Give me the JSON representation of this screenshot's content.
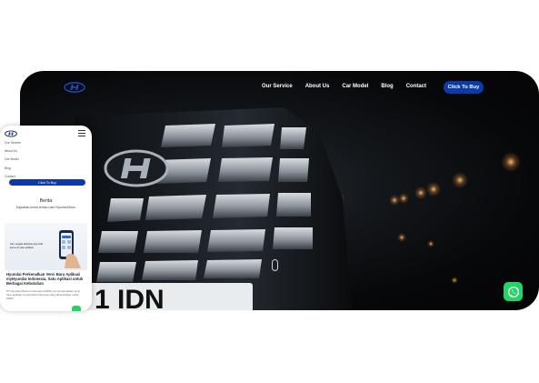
{
  "desktop": {
    "nav": {
      "items": [
        "Our Service",
        "About Us",
        "Car Model",
        "Blog",
        "Contact"
      ],
      "cta_label": "Click To Buy"
    },
    "colors": {
      "accent": "#0c3aa8",
      "whatsapp": "#25d366",
      "hero_bg": "#07080a"
    },
    "hero_plate_text": "1 IDN"
  },
  "mobile": {
    "nav": {
      "items": [
        "Our Service",
        "About Us",
        "Car Model",
        "Blog",
        "Contact"
      ],
      "cta_label": "Click To Buy"
    },
    "section_title": "Berita",
    "section_subtitle": "Dapatkan berita terbaru dari Hyundai Motor",
    "card": {
      "promo_text": "Atur segala aktivitas Hyundai kamu di satu aplikasi",
      "title": "Hyundai Perkenalkan Versi Baru Aplikasi myHyundai Indonesia, Satu Aplikasi untuk Berbagai Kebutuhan",
      "excerpt": "PT Hyundai Motors Indonesia (HMID) memperkenalkan versi baru aplikasi myHyundai Indonesia yang diinovasikan untuk HMID"
    }
  }
}
